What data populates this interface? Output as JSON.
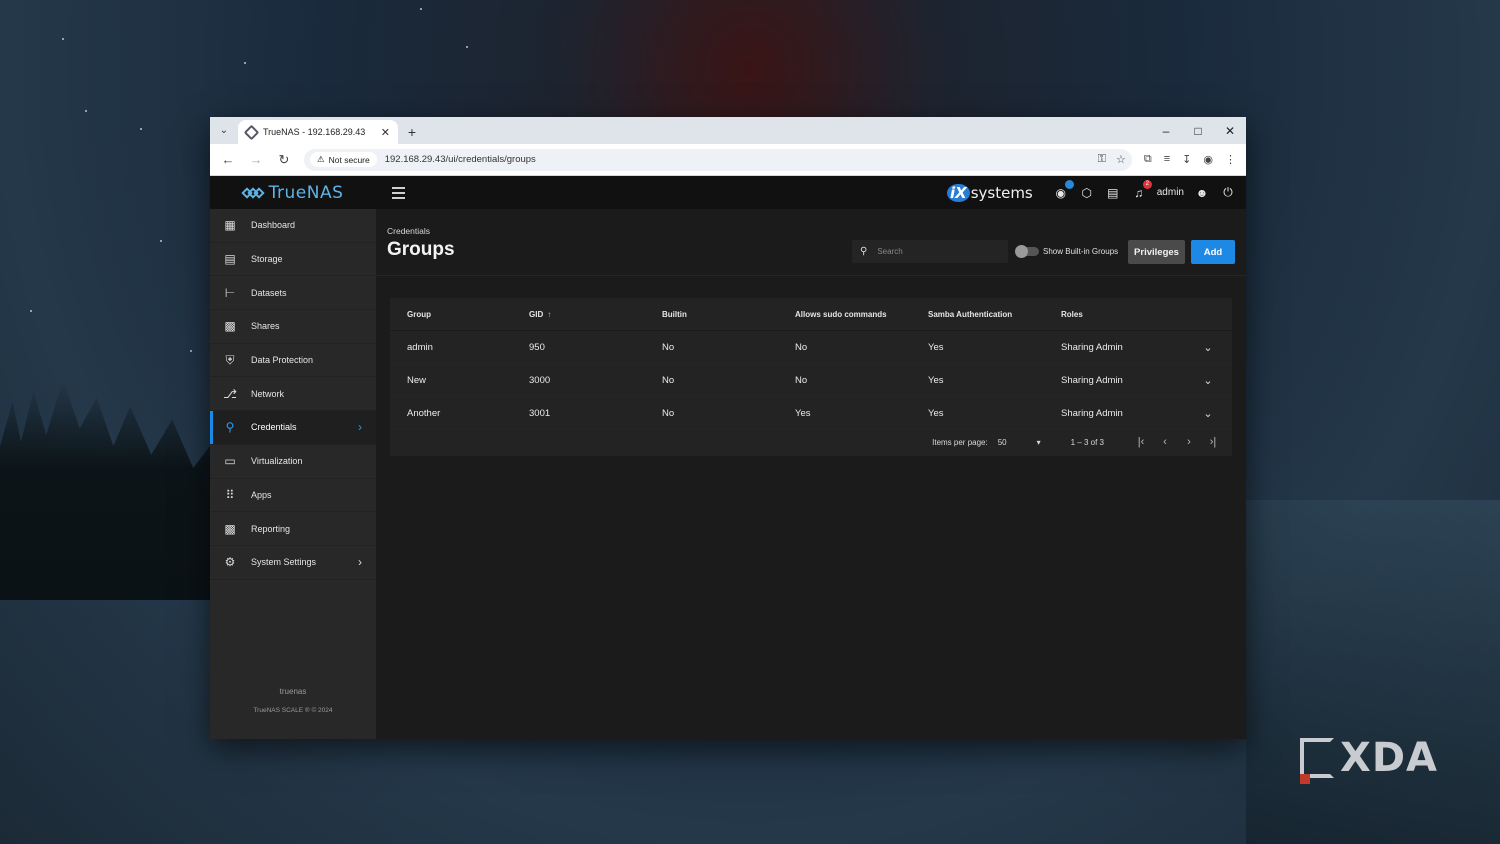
{
  "browser": {
    "tab_title": "TrueNAS - 192.168.29.43",
    "security_label": "Not secure",
    "url": "192.168.29.43/ui/credentials/groups"
  },
  "app": {
    "brand": "TrueNAS",
    "vendor_logo_prefix": "iX",
    "vendor_logo_text": "systems",
    "notifications_count": "2",
    "username": "admin"
  },
  "sidebar": {
    "items": [
      {
        "label": "Dashboard",
        "icon": "dashboard-icon"
      },
      {
        "label": "Storage",
        "icon": "storage-icon"
      },
      {
        "label": "Datasets",
        "icon": "datasets-icon"
      },
      {
        "label": "Shares",
        "icon": "shares-icon"
      },
      {
        "label": "Data Protection",
        "icon": "shield-icon"
      },
      {
        "label": "Network",
        "icon": "network-icon"
      },
      {
        "label": "Credentials",
        "icon": "key-icon"
      },
      {
        "label": "Virtualization",
        "icon": "laptop-icon"
      },
      {
        "label": "Apps",
        "icon": "apps-grid-icon"
      },
      {
        "label": "Reporting",
        "icon": "chart-icon"
      },
      {
        "label": "System Settings",
        "icon": "gear-icon"
      }
    ],
    "hostname": "truenas",
    "copyright": "TrueNAS SCALE ® © 2024"
  },
  "main": {
    "breadcrumb": "Credentials",
    "title": "Groups",
    "search_placeholder": "Search",
    "toggle_label": "Show Built-in Groups",
    "privileges_label": "Privileges",
    "add_label": "Add",
    "table": {
      "columns": [
        "Group",
        "GID",
        "Builtin",
        "Allows sudo commands",
        "Samba Authentication",
        "Roles"
      ],
      "rows": [
        [
          "admin",
          "950",
          "No",
          "No",
          "Yes",
          "Sharing Admin"
        ],
        [
          "New",
          "3000",
          "No",
          "No",
          "Yes",
          "Sharing Admin"
        ],
        [
          "Another",
          "3001",
          "No",
          "Yes",
          "Yes",
          "Sharing Admin"
        ]
      ]
    },
    "paginator": {
      "items_per_page_label": "Items per page:",
      "page_size": "50",
      "range": "1 – 3 of 3"
    }
  },
  "watermark": "XDA"
}
